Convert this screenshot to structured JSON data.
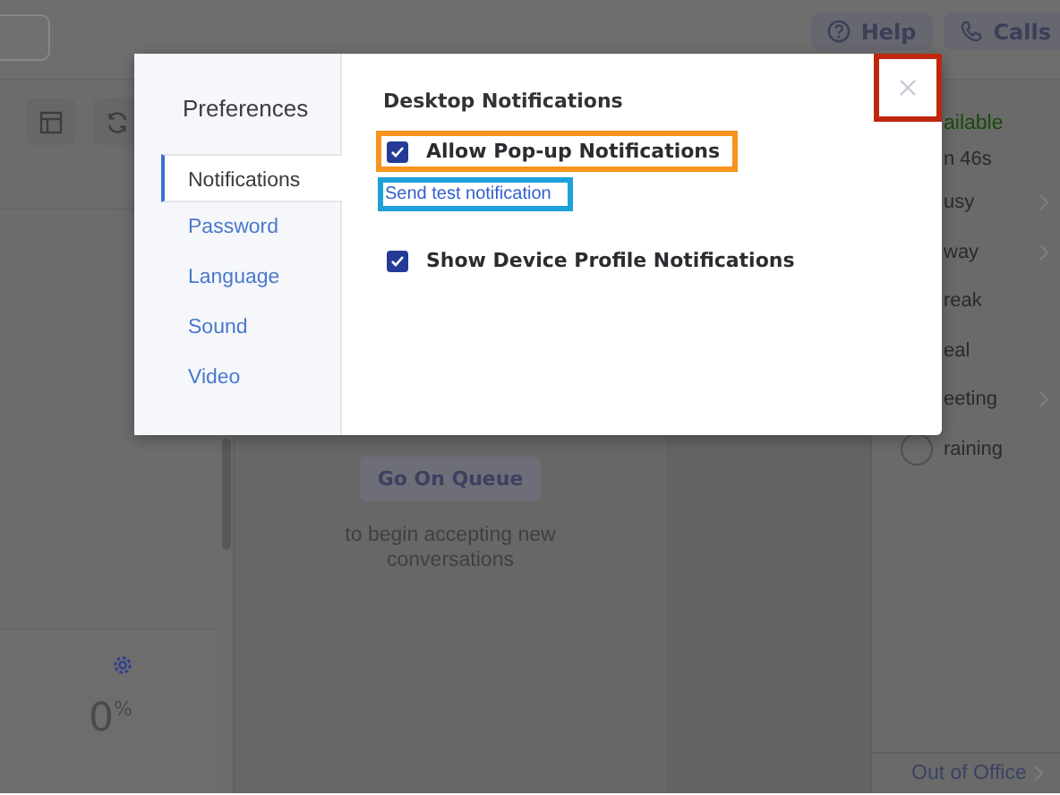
{
  "top_bar": {
    "buttons": [
      {
        "label": "Help"
      },
      {
        "label": "Calls"
      }
    ]
  },
  "queue_panel": {
    "button": "Go On Queue",
    "message": "to begin accepting new conversations"
  },
  "stats_card": {
    "value": "0$^{%}$"
  },
  "status_panel": {
    "items": [
      {
        "label": "ailable",
        "kind": "current",
        "submenu": false
      },
      {
        "label": "n 46s",
        "kind": "timer",
        "submenu": false
      },
      {
        "label": "usy",
        "kind": "status",
        "submenu": true
      },
      {
        "label": "way",
        "kind": "status",
        "submenu": true
      },
      {
        "label": "reak",
        "kind": "status",
        "submenu": false
      },
      {
        "label": "eal",
        "kind": "status",
        "submenu": false
      },
      {
        "label": "eeting",
        "kind": "status",
        "submenu": true
      },
      {
        "label": "raining",
        "kind": "radio",
        "submenu": false
      }
    ],
    "footer": "Out of Office"
  },
  "dialog": {
    "title": "Preferences",
    "nav": [
      {
        "label": "Notifications",
        "selected": true
      },
      {
        "label": "Password",
        "selected": false
      },
      {
        "label": "Language",
        "selected": false
      },
      {
        "label": "Sound",
        "selected": false
      },
      {
        "label": "Video",
        "selected": false
      }
    ],
    "section_title": "Desktop Notifications",
    "options": [
      {
        "kind": "checkbox",
        "label": "Allow Pop-up Notifications",
        "checked": true,
        "color": "#f7931e"
      },
      {
        "kind": "link",
        "label": "Send test notification",
        "color": "#1ea0d8"
      },
      {
        "kind": "checkbox",
        "label": "Show Device Profile Notifications",
        "checked": true
      }
    ],
    "close": {
      "color": "#c0250f"
    }
  }
}
